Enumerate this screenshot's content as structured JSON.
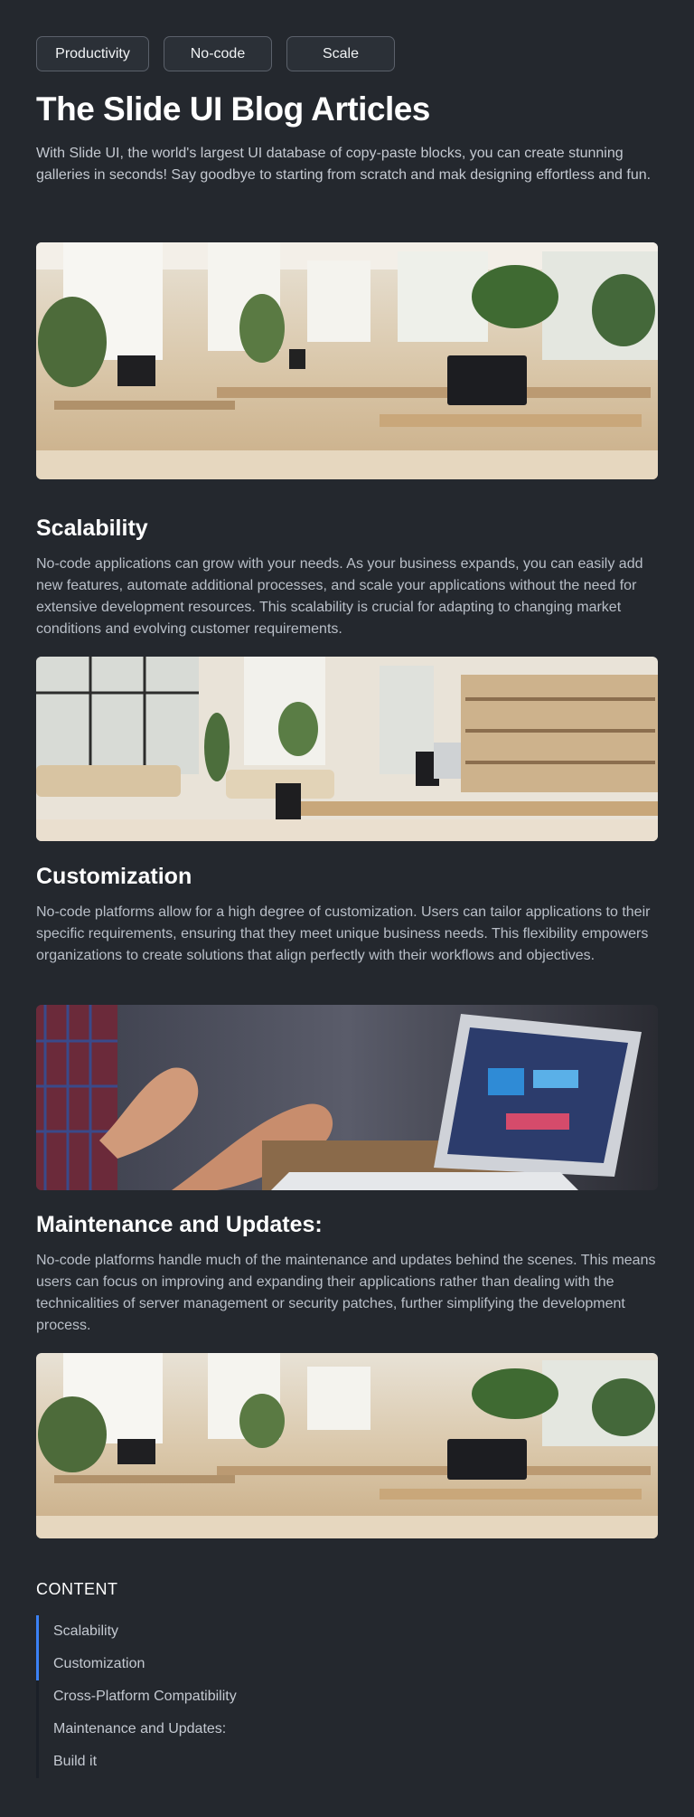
{
  "tags": [
    "Productivity",
    "No-code",
    "Scale"
  ],
  "title": "The Slide UI Blog Articles",
  "intro": "With Slide UI, the world's largest UI database of copy-paste blocks, you can create stunning galleries in seconds! Say goodbye to starting from scratch and mak designing effortless and fun.",
  "sections": [
    {
      "title": "Scalability",
      "body": "No-code applications can grow with your needs. As your business expands, you can easily add new features, automate additional processes, and scale your applications without the need for extensive development resources. This scalability is crucial for adapting to changing market conditions and evolving customer requirements."
    },
    {
      "title": "Customization",
      "body": "No-code platforms allow for a high degree of customization. Users can tailor applications to their specific requirements, ensuring that they meet unique business needs. This flexibility empowers organizations to create solutions that align perfectly with their workflows and objectives."
    },
    {
      "title": "Maintenance and Updates:",
      "body": "No-code platforms handle much of the maintenance and updates behind the scenes. This means users can focus on improving and expanding their applications rather than dealing with the technicalities of server management or security patches, further simplifying the development process."
    }
  ],
  "toc": {
    "title": "CONTENT",
    "items": [
      "Scalability",
      "Customization",
      "Cross-Platform Compatibility",
      "Maintenance and Updates:",
      "Build it"
    ],
    "active_items": [
      "Scalability",
      "Customization"
    ]
  },
  "images": [
    "office-photo",
    "office-library-photo",
    "hands-laptop-photo",
    "office-photo"
  ],
  "colors": {
    "background": "#24282e",
    "accent": "#3b82f6",
    "text": "#ffffff",
    "muted": "#b9bfc8"
  }
}
